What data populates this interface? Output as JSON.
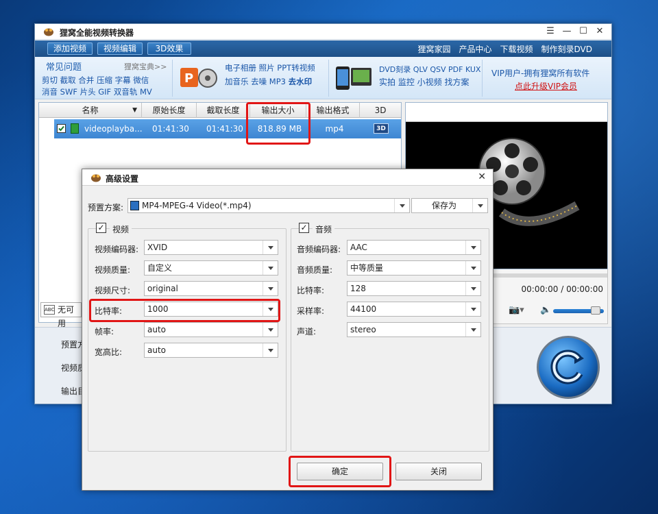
{
  "app": {
    "title": "狸窝全能视频转换器",
    "toolbar": [
      "添加视频",
      "视频编辑",
      "3D效果"
    ],
    "toplinks": [
      "狸窝家园",
      "产品中心",
      "下载视频",
      "制作刻录DVD"
    ]
  },
  "banner": {
    "faq_title": "常见问题",
    "faq_more": "狸窝宝典>>",
    "faq_row1": "剪切 截取 合并 压缩 字幕 微信",
    "faq_row2": "消音 SWF 片头 GIF 双音轨 MV",
    "ppt_row1": "电子相册 照片 PPT转视频",
    "ppt_row2_a": "加音乐 去噪 MP3 ",
    "ppt_row2_b": "去水印",
    "dvd_row1": "DVD刻录 QLV QSV PDF KUX",
    "dvd_row2": "实拍 监控 小视频 找方案",
    "vip_line1": "VIP用户-拥有狸窝所有软件",
    "vip_line2": "点此升级VIP会员"
  },
  "table": {
    "headers": [
      "名称",
      "原始长度",
      "截取长度",
      "输出大小",
      "输出格式",
      "3D"
    ],
    "row": {
      "name": "videoplayba...",
      "orig_len": "01:41:30",
      "cut_len": "01:41:30",
      "size": "818.89 MB",
      "format": "mp4",
      "badge_3d": "3D"
    }
  },
  "player": {
    "time": "00:00:00 / 00:00:00"
  },
  "bottom": {
    "subtitle_btn": "无可用",
    "labels": [
      "预置方",
      "视频质",
      "输出目"
    ]
  },
  "dialog": {
    "title": "高级设置",
    "preset_label": "预置方案:",
    "preset_value": "MP4-MPEG-4 Video(*.mp4)",
    "save_as": "保存为",
    "video": {
      "title": "视频",
      "rows": [
        {
          "label": "视频编码器:",
          "value": "XVID"
        },
        {
          "label": "视频质量:",
          "value": "自定义"
        },
        {
          "label": "视频尺寸:",
          "value": "original"
        },
        {
          "label": "比特率:",
          "value": "1000"
        },
        {
          "label": "帧率:",
          "value": "auto"
        },
        {
          "label": "宽高比:",
          "value": "auto"
        }
      ]
    },
    "audio": {
      "title": "音频",
      "rows": [
        {
          "label": "音频编码器:",
          "value": "AAC"
        },
        {
          "label": "音频质量:",
          "value": "中等质量"
        },
        {
          "label": "比特率:",
          "value": "128"
        },
        {
          "label": "采样率:",
          "value": "44100"
        },
        {
          "label": "声道:",
          "value": "stereo"
        }
      ]
    },
    "ok": "确定",
    "close": "关闭"
  },
  "colors": {
    "highlight": "#e11515",
    "accent": "#3d86d2"
  }
}
